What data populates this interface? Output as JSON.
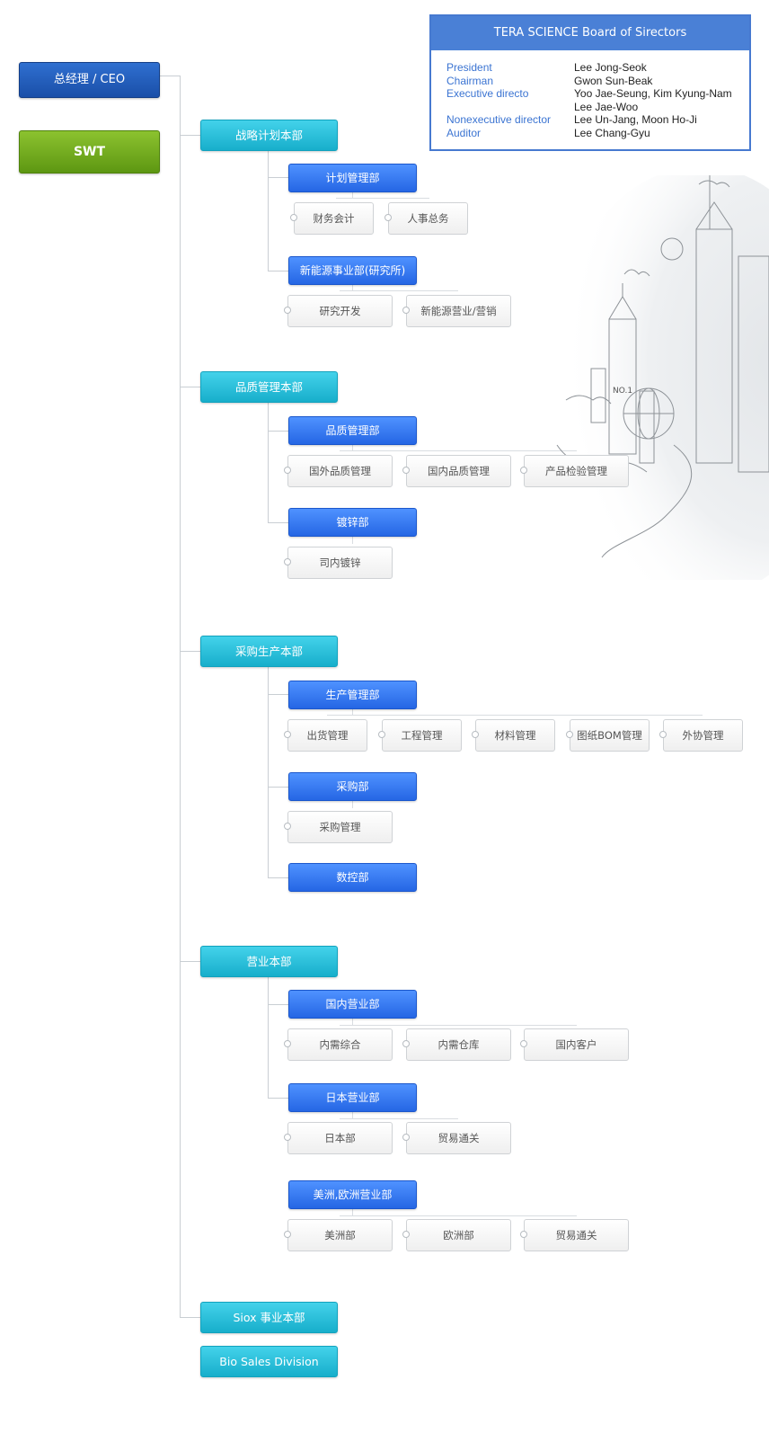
{
  "ceo": {
    "label": "总经理 / CEO"
  },
  "swt": {
    "label": "SWT"
  },
  "board": {
    "title": "TERA SCIENCE Board of Sirectors",
    "rows": [
      {
        "role": "President",
        "name": "Lee Jong-Seok"
      },
      {
        "role": "Chairman",
        "name": "Gwon Sun-Beak"
      },
      {
        "role": "Executive directo",
        "name": "Yoo Jae-Seung, Kim Kyung-Nam"
      },
      {
        "role": "",
        "name": "Lee Jae-Woo"
      },
      {
        "role": "Nonexecutive director",
        "name": "Lee Un-Jang, Moon Ho-Ji"
      },
      {
        "role": "Auditor",
        "name": "Lee Chang-Gyu"
      }
    ]
  },
  "city_badge": "NO.1",
  "divisions": [
    {
      "label": "战略计划本部",
      "departments": [
        {
          "label": "计划管理部",
          "teams": [
            "财务会计",
            "人事总务"
          ]
        },
        {
          "label": "新能源事业部(研究所)",
          "teams": [
            "研究开发",
            "新能源营业/营销"
          ]
        }
      ]
    },
    {
      "label": "品质管理本部",
      "departments": [
        {
          "label": "品质管理部",
          "teams": [
            "国外品质管理",
            "国内品质管理",
            "产品检验管理"
          ]
        },
        {
          "label": "镀锌部",
          "teams": [
            "司内镀锌"
          ]
        }
      ]
    },
    {
      "label": "采购生产本部",
      "departments": [
        {
          "label": "生产管理部",
          "teams": [
            "出货管理",
            "工程管理",
            "材料管理",
            "图纸BOM管理",
            "外协管理"
          ]
        },
        {
          "label": "采购部",
          "teams": [
            "采购管理"
          ]
        },
        {
          "label": "数控部",
          "teams": []
        }
      ]
    },
    {
      "label": "营业本部",
      "departments": [
        {
          "label": "国内营业部",
          "teams": [
            "内需综合",
            "内需仓库",
            "国内客户"
          ]
        },
        {
          "label": "日本营业部",
          "teams": [
            "日本部",
            "贸易通关"
          ]
        },
        {
          "label": "美洲,欧洲营业部",
          "teams": [
            "美洲部",
            "欧洲部",
            "贸易通关"
          ]
        }
      ]
    },
    {
      "label": "Siox 事业本部",
      "departments": []
    },
    {
      "label": "Bio Sales Division",
      "departments": []
    }
  ]
}
